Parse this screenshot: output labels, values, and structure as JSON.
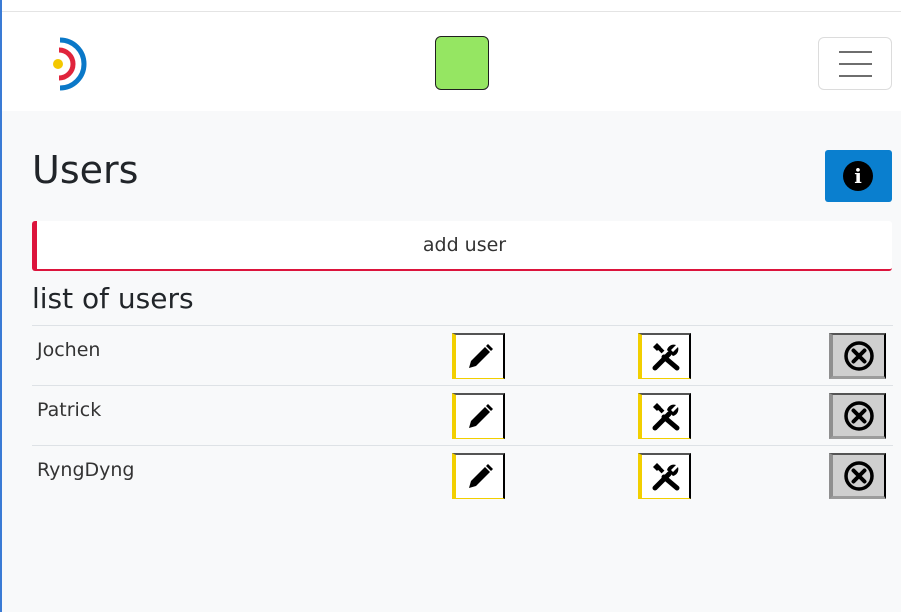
{
  "header": {
    "logo_icon": "circle-arcs-logo-icon",
    "status_color": "#95e662",
    "menu_icon": "hamburger-menu-icon"
  },
  "page": {
    "title": "Users",
    "info_icon": "info-icon",
    "add_user_label": "add user",
    "list_title": "list of users"
  },
  "users": [
    {
      "name": "Jochen"
    },
    {
      "name": "Patrick"
    },
    {
      "name": "RyngDyng"
    }
  ],
  "row_actions": {
    "edit_icon": "pencil-icon",
    "settings_icon": "tools-icon",
    "delete_icon": "close-circle-icon"
  },
  "colors": {
    "accent_blue": "#0a7fcf",
    "alert_red": "#dc143c",
    "action_yellow": "#f2cf00"
  }
}
